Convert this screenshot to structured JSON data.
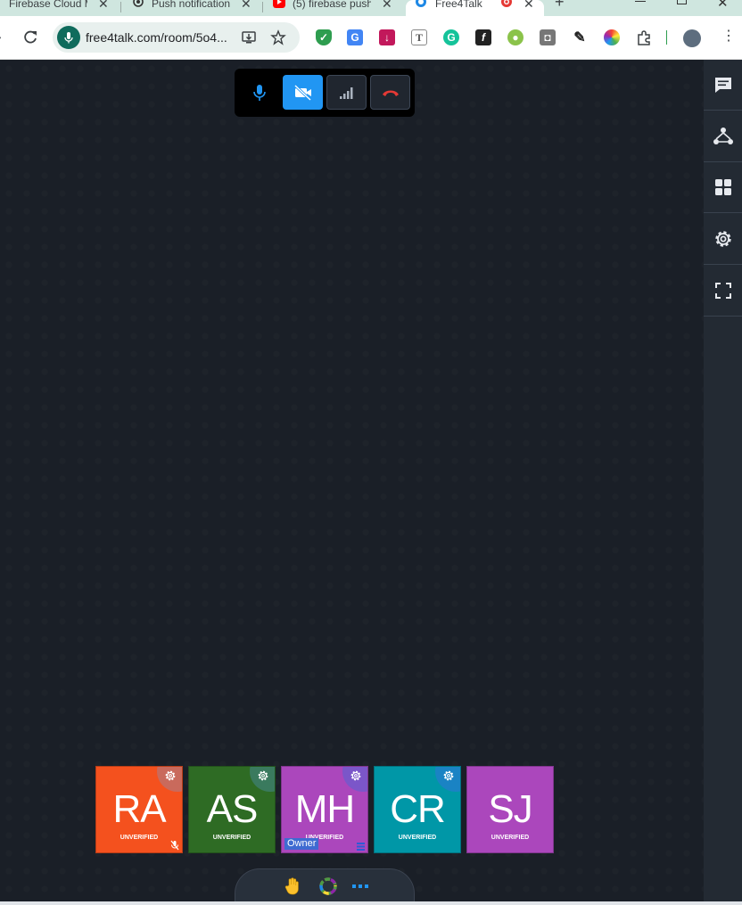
{
  "browser": {
    "tabs": [
      {
        "title": "Firebase Cloud M",
        "active": false
      },
      {
        "title": "Push notification",
        "active": false
      },
      {
        "title": "(5) firebase push",
        "active": false
      },
      {
        "title": "Free4Talk",
        "active": true
      }
    ],
    "new_tab_label": "+",
    "url": "free4talk.com/room/5o4...",
    "colors": {
      "tab_strip": "#cfe6df",
      "omnibox": "#e8f0ee",
      "mic_pill": "#0f6b5c"
    }
  },
  "call_controls": {
    "mic": "mic-icon",
    "video": "video-off-icon",
    "signal": "signal-bars-icon",
    "hangup": "hangup-icon",
    "colors": {
      "active": "#2196f3",
      "mic": "#2196f3",
      "hangup": "#e53935"
    }
  },
  "sidebar": {
    "items": [
      "chat-icon",
      "share-nodes-icon",
      "grid-icon",
      "settings-icon",
      "fullscreen-icon"
    ]
  },
  "participants": [
    {
      "initials": "RA",
      "status": "UNVERIFIED",
      "color": "#f4511e",
      "muted": true
    },
    {
      "initials": "AS",
      "status": "UNVERIFIED",
      "color": "#2e6b24"
    },
    {
      "initials": "MH",
      "status": "UNVERIFIED",
      "color": "#ab47bc",
      "badge": "Owner"
    },
    {
      "initials": "CR",
      "status": "UNVERIFIED",
      "color": "#0097a7"
    },
    {
      "initials": "SJ",
      "status": "UNVERIFIED",
      "color": "#ab47bc"
    }
  ],
  "bottom_bar": {
    "raise_hand": "raise-hand-icon",
    "color_wheel": "color-wheel-icon",
    "more": "more-dots-icon"
  }
}
